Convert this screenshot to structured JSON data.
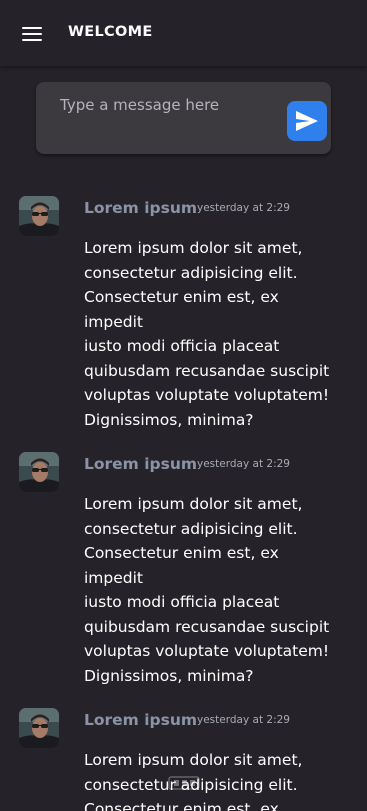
{
  "header": {
    "menu_icon": "hamburger-menu-icon",
    "title": "WELCOME"
  },
  "composer": {
    "placeholder": "Type a message here",
    "send_icon": "paper-plane-icon",
    "accent_color": "#2f80ed"
  },
  "messages": [
    {
      "author": "Lorem ipsum",
      "time": "yesterday at 2:29",
      "lines": [
        "Lorem ipsum dolor sit amet,",
        "consectetur adipisicing elit.",
        "Consectetur enim est, ex impedit",
        "iusto modi officia placeat",
        "quibusdam recusandae suscipit",
        "voluptas voluptate voluptatem!",
        "Dignissimos, minima?"
      ]
    },
    {
      "author": "Lorem ipsum",
      "time": "yesterday at 2:29",
      "lines": [
        "Lorem ipsum dolor sit amet,",
        "consectetur adipisicing elit.",
        "Consectetur enim est, ex impedit",
        "iusto modi officia placeat",
        "quibusdam recusandae suscipit",
        "voluptas voluptate voluptatem!",
        "Dignissimos, minima?"
      ]
    },
    {
      "author": "Lorem ipsum",
      "time": "yesterday at 2:29",
      "lines": [
        "Lorem ipsum dolor sit amet,",
        "consectetur adipisicing elit.",
        "Consectetur enim est, ex impedit"
      ]
    }
  ]
}
